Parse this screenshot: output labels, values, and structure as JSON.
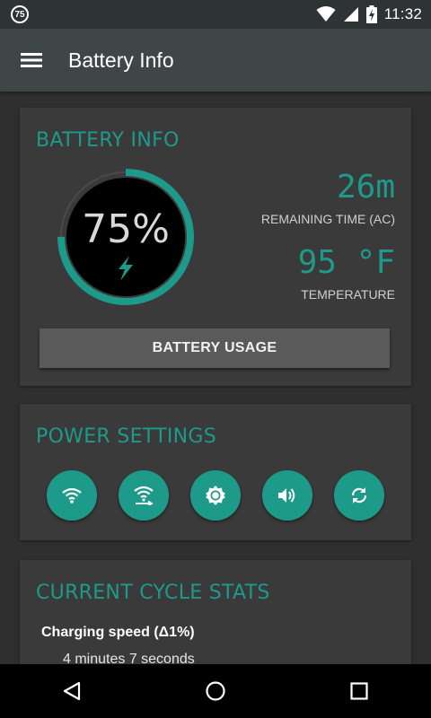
{
  "status_bar": {
    "badge_text": "75",
    "clock": "11:32",
    "icons": [
      "wifi-icon",
      "signal-icon",
      "battery-charging-icon"
    ]
  },
  "app_bar": {
    "title": "Battery Info",
    "menu_icon": "hamburger-menu-icon"
  },
  "battery_card": {
    "title": "BATTERY INFO",
    "percent": 75,
    "percent_text": "75%",
    "remaining_time": "26m",
    "remaining_label": "REMAINING TIME (AC)",
    "temperature": "95 °F",
    "temperature_label": "TEMPERATURE",
    "usage_button": "BATTERY USAGE"
  },
  "power_card": {
    "title": "POWER SETTINGS",
    "toggles": [
      {
        "name": "wifi-toggle",
        "icon": "wifi-icon"
      },
      {
        "name": "hotspot-toggle",
        "icon": "wifi-tethering-icon"
      },
      {
        "name": "brightness-toggle",
        "icon": "brightness-icon"
      },
      {
        "name": "sound-toggle",
        "icon": "volume-icon"
      },
      {
        "name": "sync-toggle",
        "icon": "sync-icon"
      }
    ]
  },
  "cycle_card": {
    "title": "CURRENT CYCLE STATS",
    "charging_speed_label": "Charging speed (Δ1%)",
    "charging_speed_value": "4 minutes 7 seconds"
  },
  "nav_bar": {
    "buttons": [
      "back-icon",
      "home-icon",
      "recents-icon"
    ]
  },
  "colors": {
    "accent": "#1d9a8a",
    "background": "#2f2f2f",
    "card": "#3a3a3a",
    "app_bar": "#3f4746",
    "status_bar": "#2e3433"
  }
}
